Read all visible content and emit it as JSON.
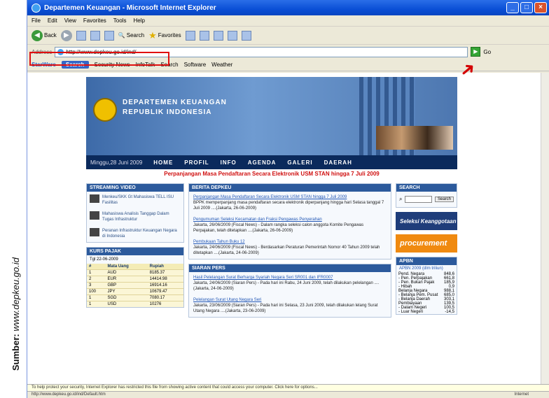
{
  "source": {
    "label": "Sumber:",
    "site": "www.depkeu.go.id"
  },
  "window": {
    "title": "Departemen Keuangan - Microsoft Internet Explorer"
  },
  "menu": [
    "File",
    "Edit",
    "View",
    "Favorites",
    "Tools",
    "Help"
  ],
  "toolbar": {
    "back": "Back",
    "search": "Search",
    "favorites": "Favorites"
  },
  "address": {
    "label": "Address",
    "url": "http://www.depkeu.go.id/ind/",
    "go": "Go"
  },
  "links": {
    "brand": "StarWare",
    "search": "Search",
    "items": [
      "Security News",
      "InfoTalk",
      "Search",
      "Software",
      "Weather"
    ]
  },
  "site": {
    "banner": {
      "line1": "DEPARTEMEN KEUANGAN",
      "line2": "REPUBLIK INDONESIA"
    },
    "date": "Minggu,28 Juni 2009",
    "nav": [
      "HOME",
      "PROFIL",
      "INFO",
      "AGENDA",
      "GALERI",
      "DAERAH"
    ],
    "ticker": "Perpanjangan Masa Pendaftaran Secara Elektronik USM STAN hingga 7 Juli 2009",
    "video": {
      "head": "STREAMING VIDEO",
      "items": [
        "Menkeu/SKK Gt Mahasiswa TELL ISU Fasilitas",
        "Mahasiswa Analisis Tanggap Dalam Tugas Infrastruktur",
        "Peranan Infrastruktur Keuangan Negara di Indonesia"
      ]
    },
    "kurs": {
      "head": "KURS PAJAK",
      "sub": "Tgl 22-06-2009",
      "cols": [
        "#",
        "Mata Uang",
        "Rupiah"
      ],
      "rows": [
        [
          "1",
          "AUD",
          "8185.37"
        ],
        [
          "2",
          "EUR",
          "14414.98"
        ],
        [
          "3",
          "GBP",
          "16914.16"
        ],
        [
          "100",
          "JPY",
          "10679.47"
        ],
        [
          "1",
          "SGD",
          "7080.17"
        ],
        [
          "1",
          "USD",
          "10276"
        ]
      ]
    },
    "news": {
      "head": "BERITA DEPKEU",
      "items": [
        {
          "title": "Perpanjangan Masa Pendaftaran Secara Elektronik USM STAN hingga 7 Juli 2009",
          "body": "BPPK memperpanjang masa pendaftaran secara elektronik diperpanjang hingga hari Selasa tanggal 7 Juli 2009 ....(Jakarta, 26-06-2009)"
        },
        {
          "title": "Pengumuman Seleksi Kecamatan dan Fraksi Pengawas Penyerahan",
          "body": "Jakarta, 26/06/2009 (Fiscal News) - Dalam rangka seleksi calon anggota Komite Pengawas Perpajakan, telah ditetapkan ....(Jakarta, 26-06-2009)"
        },
        {
          "title": "Pembukaan Tahun Buku 12",
          "body": "Jakarta, 24/06/2009 (Fiscal News) - Berdasarkan Peraturan Pemerintah Nomor 40 Tahun 2009 telah ditetapkan ....(Jakarta, 24-06-2009)"
        }
      ]
    },
    "siaran": {
      "head": "SIARAN PERS",
      "items": [
        {
          "title": "Hasil Pelelangan Surat Berharga Syariah Negara Seri SR001 dan IFR0007",
          "body": "Jakarta, 24/06/2009 (Siaran Pers) - Pada hari ini Rabu, 24 Juni 2009, telah dilakukan pelelangan ....(Jakarta, 24-06-2009)"
        },
        {
          "title": "Pelelangan Surat Utang Negara Seri",
          "body": "Jakarta, 23/06/2009 (Siaran Pers) - Pada hari ini Selasa, 23 Juni 2009, telah dilakukan lelang Surat Utang Negara ....(Jakarta, 23-06-2009)"
        }
      ]
    },
    "search": {
      "head": "SEARCH",
      "go": "Search"
    },
    "promo1": "Seleksi Keanggotaan",
    "promo2": "procurement",
    "apbn": {
      "head": "APBN",
      "sub": "APBN 2009 (dlm triliun)",
      "rows": [
        [
          "Pend. Negara",
          "848,6"
        ],
        [
          "- Pen. Perpajakan",
          "661,8"
        ],
        [
          "- Pen. Bukan Pajak",
          "185,9"
        ],
        [
          "- Hibah",
          "0,9"
        ],
        [
          "Belanja Negara",
          "988,1"
        ],
        [
          "- Belanja Pem. Pusat",
          "685,0"
        ],
        [
          "- Belanja Daerah",
          "303,1"
        ],
        [
          "Pembiayaan",
          "139,5"
        ],
        [
          "- Dalam Negeri",
          "100,5"
        ],
        [
          "- Luar Negeri",
          "-14,5"
        ]
      ]
    }
  },
  "infobar": "To help protect your security, Internet Explorer has restricted this file from showing active content that could access your computer. Click here for options...",
  "status": {
    "url": "http://www.depkeu.go.id/ind/Default.htm",
    "zone": "Internet"
  }
}
